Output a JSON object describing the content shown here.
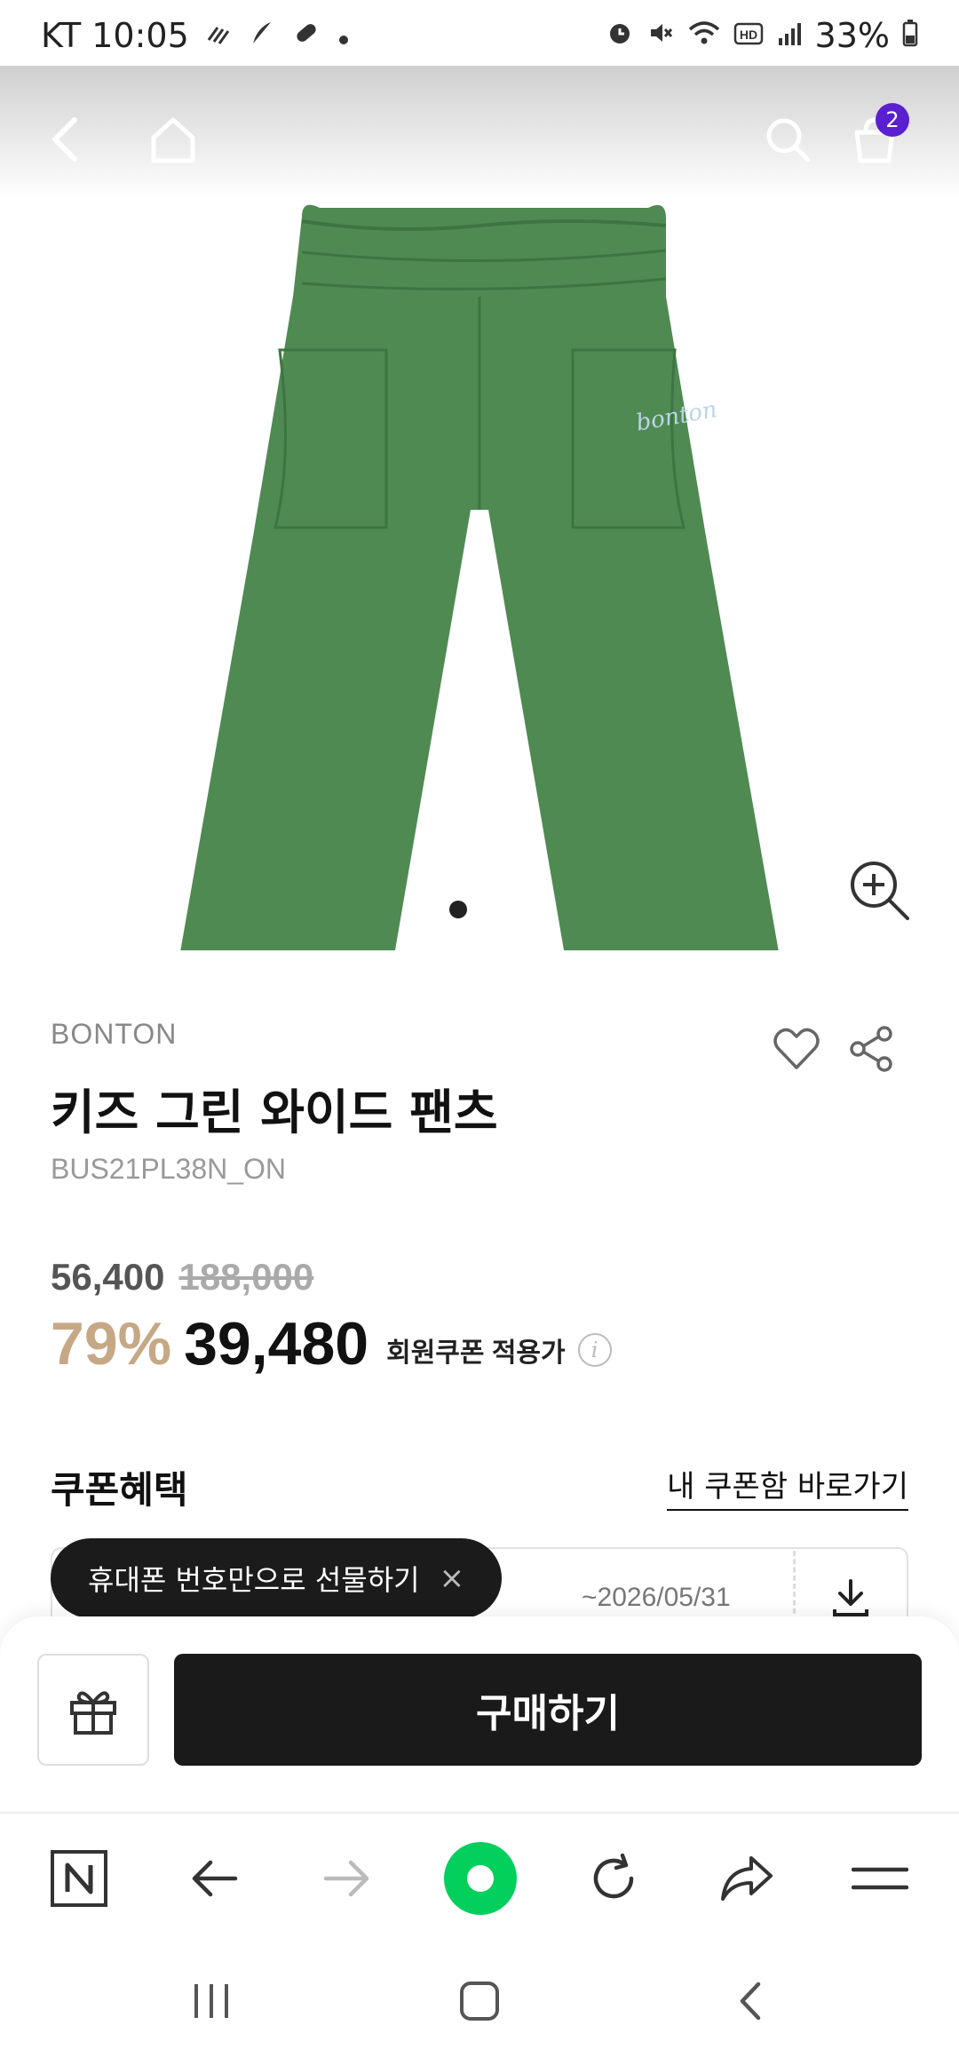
{
  "status_bar": {
    "carrier_time": "KT 10:05",
    "battery": "33%"
  },
  "top_nav": {
    "cart_count": "2"
  },
  "product": {
    "brand": "BONTON",
    "title": "키즈 그린 와이드 팬츠",
    "code": "BUS21PL38N_ON",
    "pants_color": "#4f8a52",
    "brand_script": "bonton"
  },
  "price": {
    "sale": "56,400",
    "original": "188,000",
    "discount": "79%",
    "final": "39,480",
    "final_label": "회원쿠폰 적용가"
  },
  "coupon": {
    "section_title": "쿠폰혜택",
    "link_label": "내 쿠폰함 바로가기",
    "expiry": "~2026/05/31"
  },
  "tooltip": {
    "text": "휴대폰 번호만으로 선물하기",
    "close": "×"
  },
  "purchase_bar": {
    "buy_label": "구매하기"
  },
  "browser_toolbar": {
    "items": [
      "naver-home",
      "back",
      "forward",
      "green-dot",
      "reload",
      "share",
      "menu"
    ]
  },
  "colors": {
    "accent_badge": "#5a1fd0",
    "discount": "#c6a886",
    "naver_green": "#03cf5d"
  }
}
